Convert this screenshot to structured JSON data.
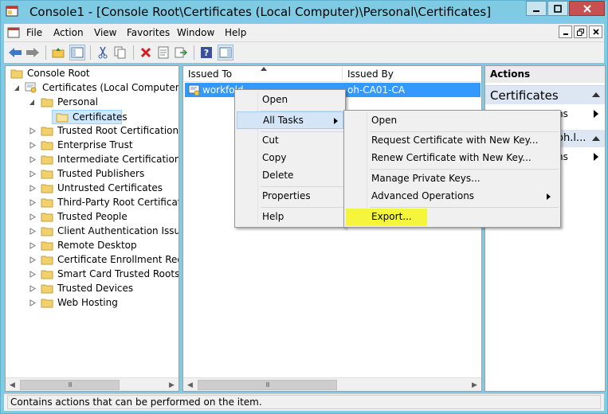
{
  "window": {
    "title": "Console1 - [Console Root\\Certificates (Local Computer)\\Personal\\Certificates]"
  },
  "menu": [
    "File",
    "Action",
    "View",
    "Favorites",
    "Window",
    "Help"
  ],
  "tree": {
    "root": "Console Root",
    "store": "Certificates (Local Computer)",
    "personal": "Personal",
    "certificates": "Certificates",
    "folders": [
      "Trusted Root Certification Au",
      "Enterprise Trust",
      "Intermediate Certification Au",
      "Trusted Publishers",
      "Untrusted Certificates",
      "Third-Party Root Certification",
      "Trusted People",
      "Client Authentication Issuers",
      "Remote Desktop",
      "Certificate Enrollment Reque",
      "Smart Card Trusted Roots",
      "Trusted Devices",
      "Web Hosting"
    ]
  },
  "list": {
    "columns": [
      "Issued To",
      "Issued By"
    ],
    "row": {
      "issued_to": "workfold",
      "issued_by": "oh-CA01-CA"
    }
  },
  "actions": {
    "header": "Actions",
    "section1": "Certificates",
    "section1_item": "ns",
    "section2": "oh.l...",
    "section2_item": "ns"
  },
  "context_menu": {
    "items": [
      "Open",
      "All Tasks",
      "Cut",
      "Copy",
      "Delete",
      "Properties",
      "Help"
    ]
  },
  "submenu": {
    "items": [
      "Open",
      "Request Certificate with New Key...",
      "Renew Certificate with New Key...",
      "Manage Private Keys...",
      "Advanced Operations",
      "Export..."
    ]
  },
  "status": "Contains actions that can be performed on the item.",
  "colors": {
    "highlight_yellow": "#f5f53b",
    "selection_blue": "#3399ff",
    "title_bar": "#7ecbe3"
  }
}
